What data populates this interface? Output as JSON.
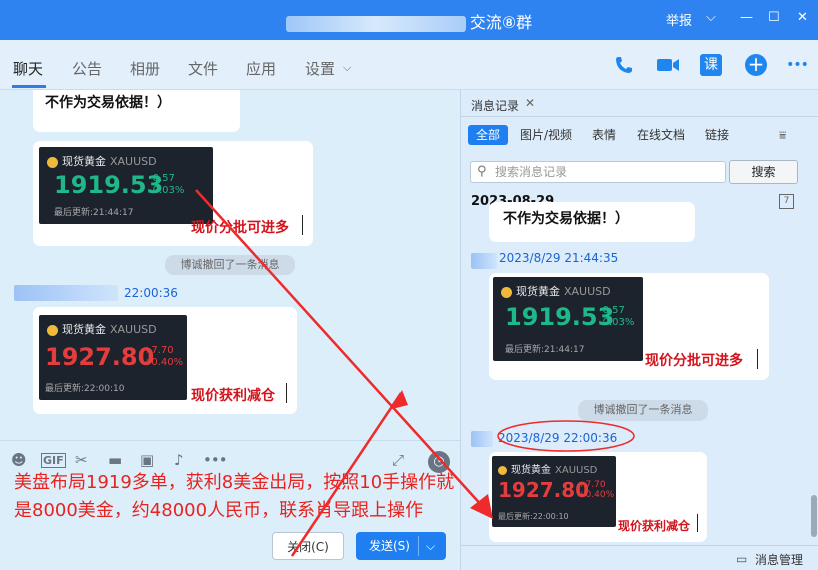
{
  "window": {
    "title_suffix": "交流⑧群",
    "report": "举报",
    "minimize": "—",
    "maximize": "☐",
    "close": "✕"
  },
  "tabs": [
    "聊天",
    "公告",
    "相册",
    "文件",
    "应用",
    "设置"
  ],
  "toolbar_icons": {
    "call": "phone-icon",
    "video": "video-icon",
    "course": "课",
    "add": "+",
    "more": "•••"
  },
  "chat": {
    "prev_text": "不作为交易依据！）",
    "card1": {
      "title": "现货黄金",
      "symbol": "XAUUSD",
      "price": "1919.53",
      "change": "-0.57",
      "pct": "-0.03%",
      "updated": "最后更新:21:44:17",
      "note": "现价分批可进多"
    },
    "recall_msg": "博诚撤回了一条消息",
    "timestamp": "22:00:36",
    "card2": {
      "title": "现货黄金",
      "symbol": "XAUUSD",
      "price": "1927.80",
      "change": "+7.70",
      "pct": "+0.40%",
      "updated": "最后更新:22:00:10",
      "note": "现价获利减仓"
    }
  },
  "input": {
    "text": "美盘布局1919多单，获利8美金出局，按照10手操作就是8000美金，约48000人民币，联系肖导跟上操作",
    "gif": "GIF",
    "close_btn": "关闭(C)",
    "send_btn": "发送(S)"
  },
  "history": {
    "tab": "消息记录",
    "filters": [
      "全部",
      "图片/视频",
      "表情",
      "在线文档",
      "链接"
    ],
    "search_placeholder": "搜索消息记录",
    "search_btn": "搜索",
    "date": "2023-08-29",
    "prev_text": "不作为交易依据！）",
    "ts1": "2023/8/29 21:44:35",
    "card1": {
      "title": "现货黄金",
      "symbol": "XAUUSD",
      "price": "1919.53",
      "change": "-0.57",
      "pct": "-0.03%",
      "updated": "最后更新:21:44:17",
      "note": "现价分批可进多"
    },
    "recall_msg": "博诚撤回了一条消息",
    "ts2": "2023/8/29 22:00:36",
    "card2": {
      "title": "现货黄金",
      "symbol": "XAUUSD",
      "price": "1927.80",
      "change": "+7.70",
      "pct": "+0.40%",
      "updated": "最后更新:22:00:10",
      "note": "现价获利减仓"
    },
    "manage": "消息管理"
  },
  "colors": {
    "accent": "#2f83f0",
    "price_down": "#1fb88a",
    "price_up": "#e33d3d",
    "annotation": "#ee2a2a"
  }
}
